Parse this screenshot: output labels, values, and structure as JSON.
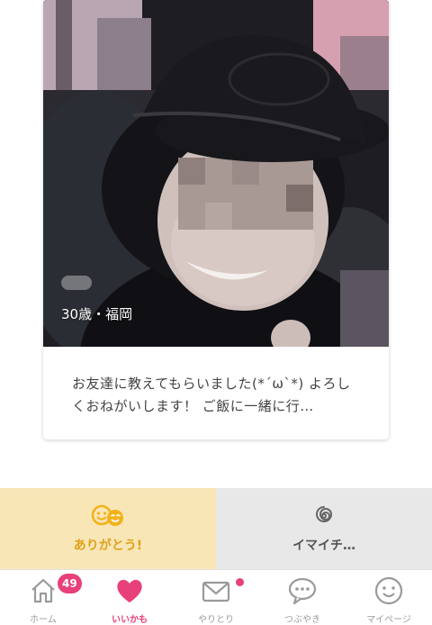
{
  "profile": {
    "meta": "30歳・福岡",
    "bio": "お友達に教えてもらいました(*´ω`*) よろしくおねがいします！ ご飯に一緒に行…"
  },
  "reactions": {
    "like_label": "ありがとう!",
    "meh_label": "イマイチ…"
  },
  "tabs": [
    {
      "label": "ホーム",
      "icon": "home-icon",
      "badge": "49"
    },
    {
      "label": "いいかも",
      "icon": "heart-icon",
      "active": true
    },
    {
      "label": "やりとり",
      "icon": "mail-icon",
      "dot": true
    },
    {
      "label": "つぶやき",
      "icon": "speech-bubble-icon"
    },
    {
      "label": "マイページ",
      "icon": "smiley-icon"
    }
  ],
  "colors": {
    "accent": "#e8407a",
    "like_bg": "#f8e6b6",
    "like_text": "#e0a21c",
    "meh_bg": "#e8e8e8"
  }
}
